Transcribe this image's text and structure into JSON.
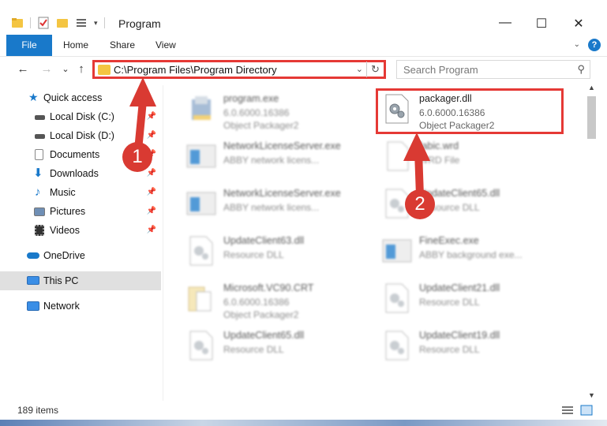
{
  "window": {
    "title": "Program",
    "minimize": "—",
    "maximize": "☐",
    "close": "✕"
  },
  "ribbon": {
    "tabs": [
      "File",
      "Home",
      "Share",
      "View"
    ],
    "help": "?"
  },
  "navigation": {
    "back": "←",
    "forward": "→",
    "recent": "⌄",
    "up": "↑",
    "address_path": "C:\\Program Files\\Program Directory",
    "address_dropdown": "⌄",
    "refresh": "↻",
    "search_placeholder": "Search Program",
    "search_icon": "⚲"
  },
  "sidebar": {
    "quick_access": "Quick access",
    "items": [
      {
        "label": "Local Disk (C:)",
        "pinned": true
      },
      {
        "label": "Local Disk (D:)",
        "pinned": true
      },
      {
        "label": "Documents",
        "pinned": true
      },
      {
        "label": "Downloads",
        "pinned": true
      },
      {
        "label": "Music",
        "pinned": true
      },
      {
        "label": "Pictures",
        "pinned": true
      },
      {
        "label": "Videos",
        "pinned": true
      }
    ],
    "pin_glyph": "📌",
    "onedrive": "OneDrive",
    "this_pc": "This PC",
    "network": "Network"
  },
  "files": [
    {
      "name": "program.exe",
      "l2": "6.0.6000.16386",
      "l3": "Object Packager2",
      "kind": "exe-installer"
    },
    {
      "name": "packager.dll",
      "l2": "6.0.6000.16386",
      "l3": "Object Packager2",
      "kind": "dll",
      "highlighted": true
    },
    {
      "name": "NetworkLicenseServer.exe",
      "l2": "ABBY network licens...",
      "l3": "",
      "kind": "exe-window"
    },
    {
      "name": "fabic.wrd",
      "l2": "WRD File",
      "l3": "",
      "kind": "blank"
    },
    {
      "name": "NetworkLicenseServer.exe",
      "l2": "ABBY network licens...",
      "l3": "",
      "kind": "exe-window"
    },
    {
      "name": "UpdateClient65.dll",
      "l2": "Resource DLL",
      "l3": "",
      "kind": "dll"
    },
    {
      "name": "UpdateClient63.dll",
      "l2": "Resource DLL",
      "l3": "",
      "kind": "dll"
    },
    {
      "name": "FineExec.exe",
      "l2": "ABBY background exe...",
      "l3": "",
      "kind": "exe-window"
    },
    {
      "name": "Microsoft.VC90.CRT",
      "l2": "6.0.6000.16386",
      "l3": "Object Packager2",
      "kind": "folder-doc"
    },
    {
      "name": "UpdateClient21.dll",
      "l2": "Resource DLL",
      "l3": "",
      "kind": "dll"
    },
    {
      "name": "UpdateClient65.dll",
      "l2": "Resource DLL",
      "l3": "",
      "kind": "dll"
    },
    {
      "name": "UpdateClient19.dll",
      "l2": "Resource DLL",
      "l3": "",
      "kind": "dll"
    }
  ],
  "status": {
    "item_count": "189 items"
  },
  "callouts": [
    "1",
    "2"
  ],
  "colors": {
    "accent": "#1979ca",
    "highlight": "#e53935",
    "callout": "#d93a32"
  }
}
